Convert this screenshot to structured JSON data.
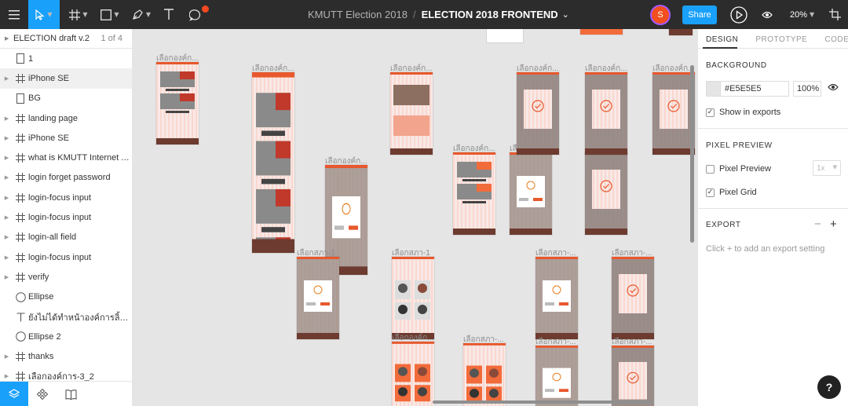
{
  "toolbar": {
    "project": "KMUTT Election 2018",
    "separator": "/",
    "file": "ELECTION 2018 FRONTEND",
    "file_caret": "⌄",
    "avatar_initial": "S",
    "share_label": "Share",
    "zoom": "20%",
    "icons": [
      "menu-icon",
      "move-icon",
      "frame-icon",
      "rectangle-icon",
      "pen-icon",
      "text-icon",
      "comment-icon",
      "present-icon",
      "eye-icon",
      "resources-icon"
    ],
    "accent": "#18a0fb"
  },
  "layers": {
    "page_name": "ELECTION draft v.2",
    "page_count": "1 of 4",
    "items": [
      {
        "name": "1",
        "type": "rect",
        "chevron": false
      },
      {
        "name": "iPhone SE",
        "type": "frame",
        "chevron": true,
        "selected": true
      },
      {
        "name": "BG",
        "type": "rect",
        "chevron": false
      },
      {
        "name": "landing page",
        "type": "frame",
        "chevron": true
      },
      {
        "name": "iPhone SE",
        "type": "frame",
        "chevron": true
      },
      {
        "name": "what is KMUTT Internet Acc",
        "type": "frame",
        "chevron": true
      },
      {
        "name": "login forget password",
        "type": "frame",
        "chevron": true
      },
      {
        "name": "login-focus input",
        "type": "frame",
        "chevron": true
      },
      {
        "name": "login-focus input",
        "type": "frame",
        "chevron": true
      },
      {
        "name": "login-all field",
        "type": "frame",
        "chevron": true
      },
      {
        "name": "login-focus input",
        "type": "frame",
        "chevron": true
      },
      {
        "name": "verify",
        "type": "frame",
        "chevron": true
      },
      {
        "name": "Ellipse",
        "type": "ellipse",
        "chevron": false
      },
      {
        "name": "ยังไม่ได้ทำหน้าองค์การลิ้งไปหน้...",
        "type": "text",
        "chevron": false
      },
      {
        "name": "Ellipse 2",
        "type": "ellipse",
        "chevron": false
      },
      {
        "name": "thanks",
        "type": "frame",
        "chevron": true
      },
      {
        "name": "เลือกองค์การ-3_2",
        "type": "frame",
        "chevron": true
      }
    ]
  },
  "canvas": {
    "background": "#e5e5e5",
    "frames": [
      {
        "label": "เลือกองค์ก...",
        "kind": "list"
      },
      {
        "label": "เลือกองค์ก...",
        "kind": "long"
      },
      {
        "label": "เลือกองค์ก...",
        "kind": "modal"
      },
      {
        "label": "เลือกองค์ก...",
        "kind": "grid"
      },
      {
        "label": "เลือกองค์ก...",
        "kind": "list-orange"
      },
      {
        "label": "เลือกองค์ก...",
        "kind": "modal"
      },
      {
        "label": "เลือกองค์ก...",
        "kind": "success"
      },
      {
        "label": "เลือกองค์ก...",
        "kind": "success"
      },
      {
        "label": "เลือกองค์ก...",
        "kind": "success"
      },
      {
        "label": "เลือกสภา-1",
        "kind": "modal"
      },
      {
        "label": "เลือกสภา-1",
        "kind": "faces"
      },
      {
        "label": "เลือกสภา-...",
        "kind": "modal"
      },
      {
        "label": "เลือกสภา-...",
        "kind": "success"
      },
      {
        "label": "เลือกองค์ก...",
        "kind": "faces-orange"
      },
      {
        "label": "เลือกสภา-...",
        "kind": "faces-orange"
      },
      {
        "label": "เลือกสภา-...",
        "kind": "modal"
      },
      {
        "label": "เลือกสภา-...",
        "kind": "success"
      }
    ]
  },
  "properties": {
    "tabs": [
      "DESIGN",
      "PROTOTYPE",
      "CODE"
    ],
    "active_tab": "DESIGN",
    "background": {
      "title": "BACKGROUND",
      "hex": "#E5E5E5",
      "opacity": "100%",
      "show_in_exports": "Show in exports",
      "show_in_exports_checked": true
    },
    "pixel_preview": {
      "title": "PIXEL PREVIEW",
      "preview_label": "Pixel Preview",
      "preview_checked": false,
      "scale": "1x",
      "grid_label": "Pixel Grid",
      "grid_checked": true
    },
    "export": {
      "title": "EXPORT",
      "hint": "Click + to add an export setting",
      "add": "+",
      "remove": "−"
    },
    "help": "?"
  }
}
